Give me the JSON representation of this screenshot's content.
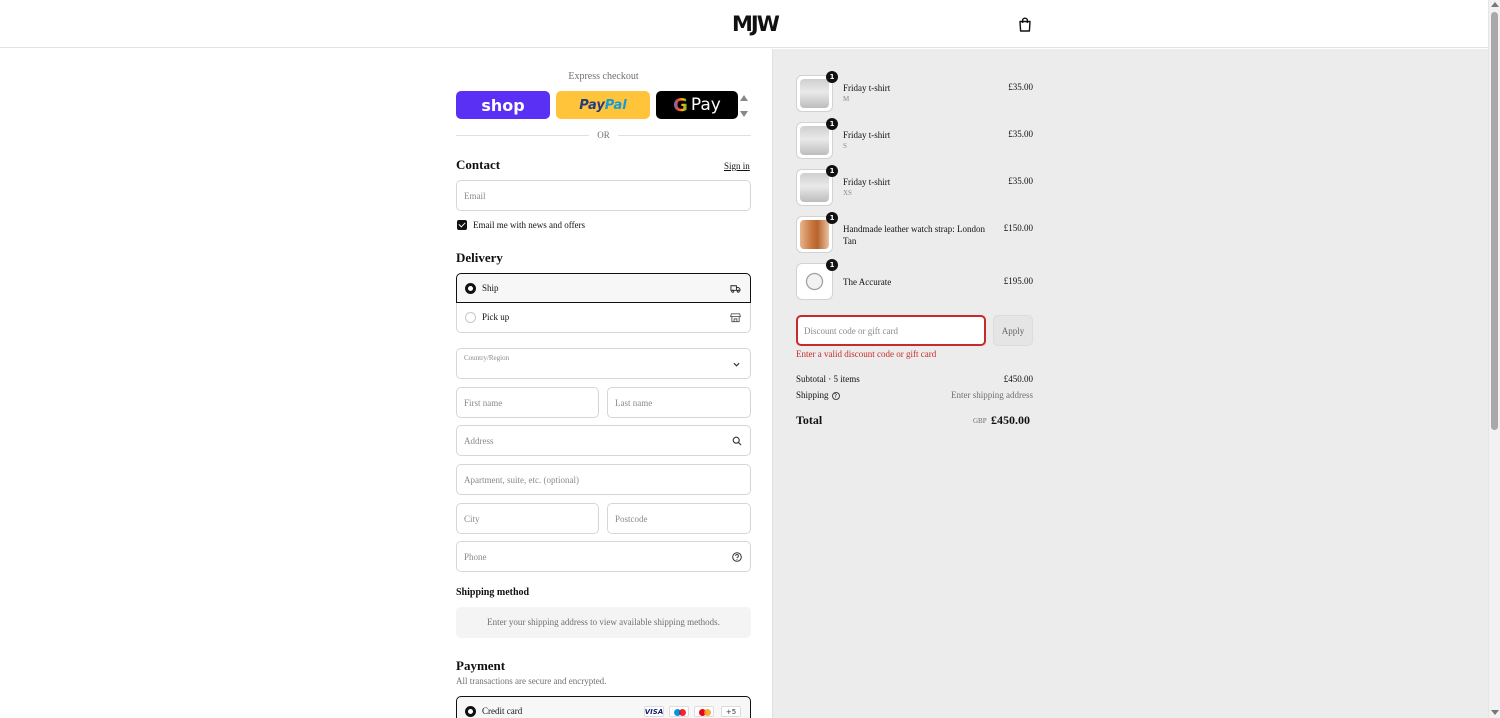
{
  "header": {
    "logo": "MJW",
    "cart_icon": "shopping-bag-icon"
  },
  "express": {
    "label": "Express checkout",
    "shop_label": "shop",
    "paypal_label_1": "Pay",
    "paypal_label_2": "Pal",
    "gpay_g": "G",
    "gpay_label": "Pay",
    "divider": "OR"
  },
  "contact": {
    "title": "Contact",
    "sign_in": "Sign in",
    "email_placeholder": "Email",
    "news_label": "Email me with news and offers",
    "news_checked": true
  },
  "delivery": {
    "title": "Delivery",
    "options": [
      {
        "label": "Ship",
        "selected": true,
        "icon": "truck-icon"
      },
      {
        "label": "Pick up",
        "selected": false,
        "icon": "store-icon"
      }
    ],
    "country_label": "Country/Region",
    "country_value": "",
    "first_name_placeholder": "First name",
    "last_name_placeholder": "Last name",
    "address_placeholder": "Address",
    "apartment_placeholder": "Apartment, suite, etc. (optional)",
    "city_placeholder": "City",
    "postcode_placeholder": "Postcode",
    "phone_placeholder": "Phone"
  },
  "shipping_method": {
    "title": "Shipping method",
    "message": "Enter your shipping address to view available shipping methods."
  },
  "payment": {
    "title": "Payment",
    "subtitle": "All transactions are secure and encrypted.",
    "option_label": "Credit card",
    "card_visa": "VISA",
    "card_more": "+5"
  },
  "summary": {
    "items": [
      {
        "name": "Friday t-shirt",
        "variant": "M",
        "price": "£35.00",
        "qty": "1"
      },
      {
        "name": "Friday t-shirt",
        "variant": "S",
        "price": "£35.00",
        "qty": "1"
      },
      {
        "name": "Friday t-shirt",
        "variant": "XS",
        "price": "£35.00",
        "qty": "1"
      },
      {
        "name": "Handmade leather watch strap: London Tan",
        "variant": "",
        "price": "£150.00",
        "qty": "1"
      },
      {
        "name": "The Accurate",
        "variant": "",
        "price": "£195.00",
        "qty": "1"
      }
    ],
    "discount_placeholder": "Discount code or gift card",
    "apply_label": "Apply",
    "error": "Enter a valid discount code or gift card",
    "subtotal_label": "Subtotal · 5 items",
    "subtotal_value": "£450.00",
    "shipping_label": "Shipping",
    "shipping_value": "Enter shipping address",
    "total_label": "Total",
    "currency": "GBP",
    "total_value": "£450.00"
  },
  "colors": {
    "shop": "#5a31f4",
    "paypal": "#ffc439",
    "error": "#c82a2a",
    "summary_bg": "#ececec"
  }
}
